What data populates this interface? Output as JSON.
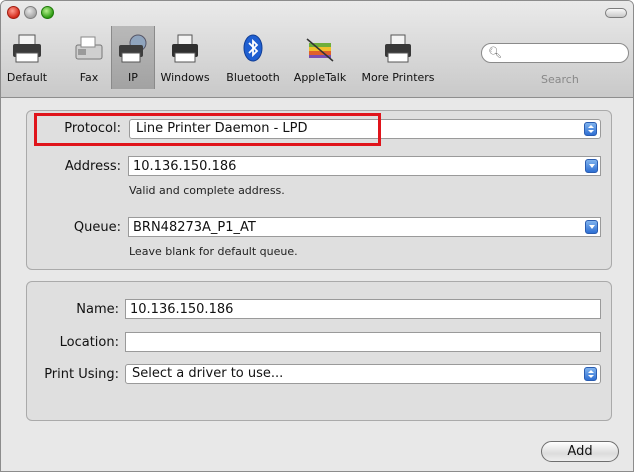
{
  "toolbar": {
    "items": [
      {
        "label": "Default",
        "icon": "printer-icon"
      },
      {
        "label": "Fax",
        "icon": "fax-icon"
      },
      {
        "label": "IP",
        "icon": "ip-printer-icon"
      },
      {
        "label": "Windows",
        "icon": "windows-printer-icon"
      },
      {
        "label": "Bluetooth",
        "icon": "bluetooth-icon"
      },
      {
        "label": "AppleTalk",
        "icon": "appletalk-icon"
      },
      {
        "label": "More Printers",
        "icon": "more-printers-icon"
      }
    ],
    "selected": "IP",
    "search_label": "Search",
    "search_value": ""
  },
  "connection": {
    "protocol_label": "Protocol:",
    "protocol_value": "Line Printer Daemon - LPD",
    "address_label": "Address:",
    "address_value": "10.136.150.186",
    "address_note": "Valid and complete address.",
    "queue_label": "Queue:",
    "queue_value": "BRN48273A_P1_AT",
    "queue_note": "Leave blank for default queue."
  },
  "details": {
    "name_label": "Name:",
    "name_value": "10.136.150.186",
    "location_label": "Location:",
    "location_value": "",
    "print_using_label": "Print Using:",
    "print_using_value": "Select a driver to use..."
  },
  "add_label": "Add",
  "colors": {
    "highlight": "#e0141b",
    "accent": "#2e6fd3"
  }
}
